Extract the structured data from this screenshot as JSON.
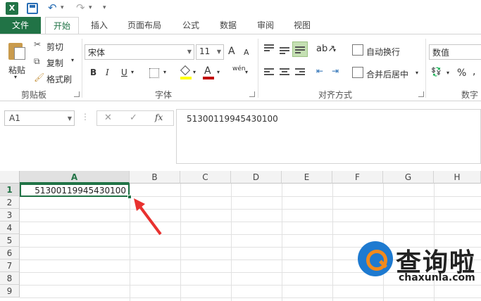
{
  "quick_access": {
    "app_icon_letter": "X",
    "icons": [
      "excel-logo-icon",
      "save-icon",
      "undo-icon",
      "redo-icon",
      "customize-qat-icon"
    ]
  },
  "tabs": [
    "文件",
    "开始",
    "插入",
    "页面布局",
    "公式",
    "数据",
    "审阅",
    "视图"
  ],
  "active_tab": "开始",
  "clipboard": {
    "paste": "粘贴",
    "cut": "剪切",
    "copy": "复制",
    "format_painter": "格式刷",
    "group_label": "剪贴板"
  },
  "font": {
    "name": "宋体",
    "size": "11",
    "grow": "A",
    "shrink": "A",
    "bold": "B",
    "italic": "I",
    "underline": "U",
    "phonetic": "wén",
    "font_color_letter": "A",
    "group_label": "字体"
  },
  "alignment": {
    "wrap_text": "自动换行",
    "merge_center": "合并后居中",
    "group_label": "对齐方式"
  },
  "number": {
    "format": "数值",
    "percent": "%",
    "group_label": "数字"
  },
  "formula_bar": {
    "name_box": "A1",
    "cancel": "✕",
    "enter": "✓",
    "fx": "fx",
    "content": "51300119945430100"
  },
  "sheet": {
    "columns": [
      "A",
      "B",
      "C",
      "D",
      "E",
      "F",
      "G",
      "H"
    ],
    "rows": [
      "1",
      "2",
      "3",
      "4",
      "5",
      "6",
      "7",
      "8",
      "9"
    ],
    "selected_cell": "A1",
    "a1_value": "51300119945430100"
  },
  "watermark": {
    "title": "查询啦",
    "url": "chaxunla.com"
  },
  "colors": {
    "accent": "#217346",
    "arrow": "#e8312f",
    "watermark_blue": "#1e7ad0",
    "watermark_orange": "#f28a1c"
  }
}
